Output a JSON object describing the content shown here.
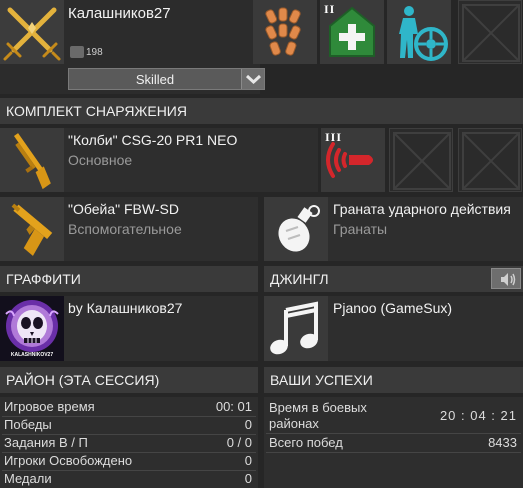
{
  "player": {
    "name": "Калашников27",
    "badge_count": "198",
    "skill_label": "Skilled",
    "avatar_icon": "crossed-swords-icon",
    "slots": [
      {
        "icon": "ammo-belt-icon",
        "tier": ""
      },
      {
        "icon": "medkit-icon",
        "tier": "II"
      },
      {
        "icon": "driver-icon",
        "tier": ""
      },
      {
        "icon": "empty-slot-icon",
        "tier": ""
      }
    ]
  },
  "loadout": {
    "header": "КОМПЛЕКТ СНАРЯЖЕНИЯ",
    "primary": {
      "name": "\"Колби\" CSG-20 PR1 NEO",
      "type": "Основное",
      "icon": "shotgun-icon"
    },
    "primary_mod": {
      "tier": "III",
      "icon": "ammo-sound-icon"
    },
    "secondary": {
      "name": "\"Обейа\" FBW-SD",
      "type": "Вспомогательное",
      "icon": "pistol-icon"
    },
    "grenade": {
      "name": "Граната ударного действия",
      "type": "Гранаты",
      "icon": "grenade-icon"
    }
  },
  "graffiti": {
    "header": "ГРАФФИТИ",
    "author": "by Калашников27",
    "image_text": "KALASHNIKOV27"
  },
  "jingle": {
    "header": "ДЖИНГЛ",
    "title": "Pjanoo (GameSux)",
    "icon": "music-note-icon",
    "speaker_icon": "speaker-icon"
  },
  "district": {
    "header": "РАЙОН (ЭТА СЕССИЯ)",
    "rows": [
      {
        "label": "Игровое время",
        "value": "00: 01"
      },
      {
        "label": "Победы",
        "value": "0"
      },
      {
        "label": "Задания В / П",
        "value": "0 / 0"
      },
      {
        "label": "Игроки Освобождено",
        "value": "0"
      },
      {
        "label": "Медали",
        "value": "0"
      }
    ]
  },
  "achievements": {
    "header": "ВАШИ УСПЕХИ",
    "combat_label": "Время в боевых районах",
    "combat_value": "20 : 04 : 21",
    "wins_label": "Всего побед",
    "wins_value": "8433"
  },
  "colors": {
    "gold": "#e3a21c",
    "red_accent": "#d4262b",
    "green_accent": "#2f8a3a",
    "cyan_accent": "#2fb6c9",
    "orange_accent": "#e0894a"
  }
}
